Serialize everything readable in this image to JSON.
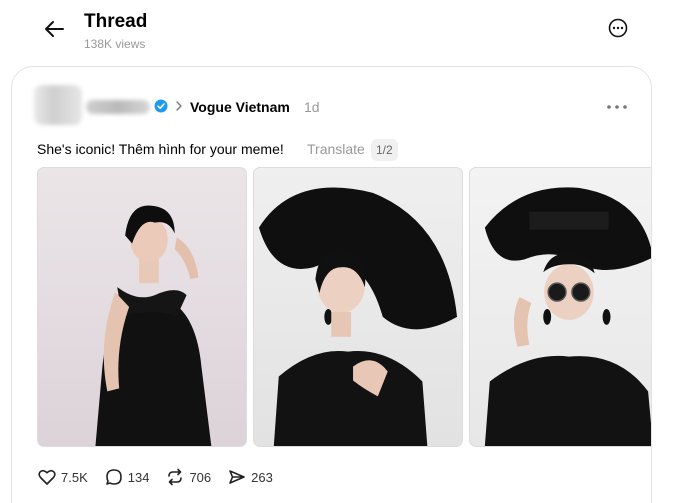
{
  "header": {
    "title": "Thread",
    "views": "138K views"
  },
  "post": {
    "account": "Vogue Vietnam",
    "time": "1d",
    "caption": "She's iconic! Thêm hình for your meme!",
    "translate_label": "Translate",
    "media_counter": "1/2",
    "stats": {
      "likes": "7.5K",
      "replies": "134",
      "reposts": "706",
      "shares": "263"
    }
  },
  "colors": {
    "verified": "#1d9bf0",
    "muted": "#999999",
    "border": "#e2e2e2"
  },
  "icons": [
    "back-arrow-icon",
    "more-circle-icon",
    "verified-icon",
    "chevron-right-icon",
    "more-horizontal-icon",
    "heart-icon",
    "comment-icon",
    "repost-icon",
    "share-icon"
  ]
}
